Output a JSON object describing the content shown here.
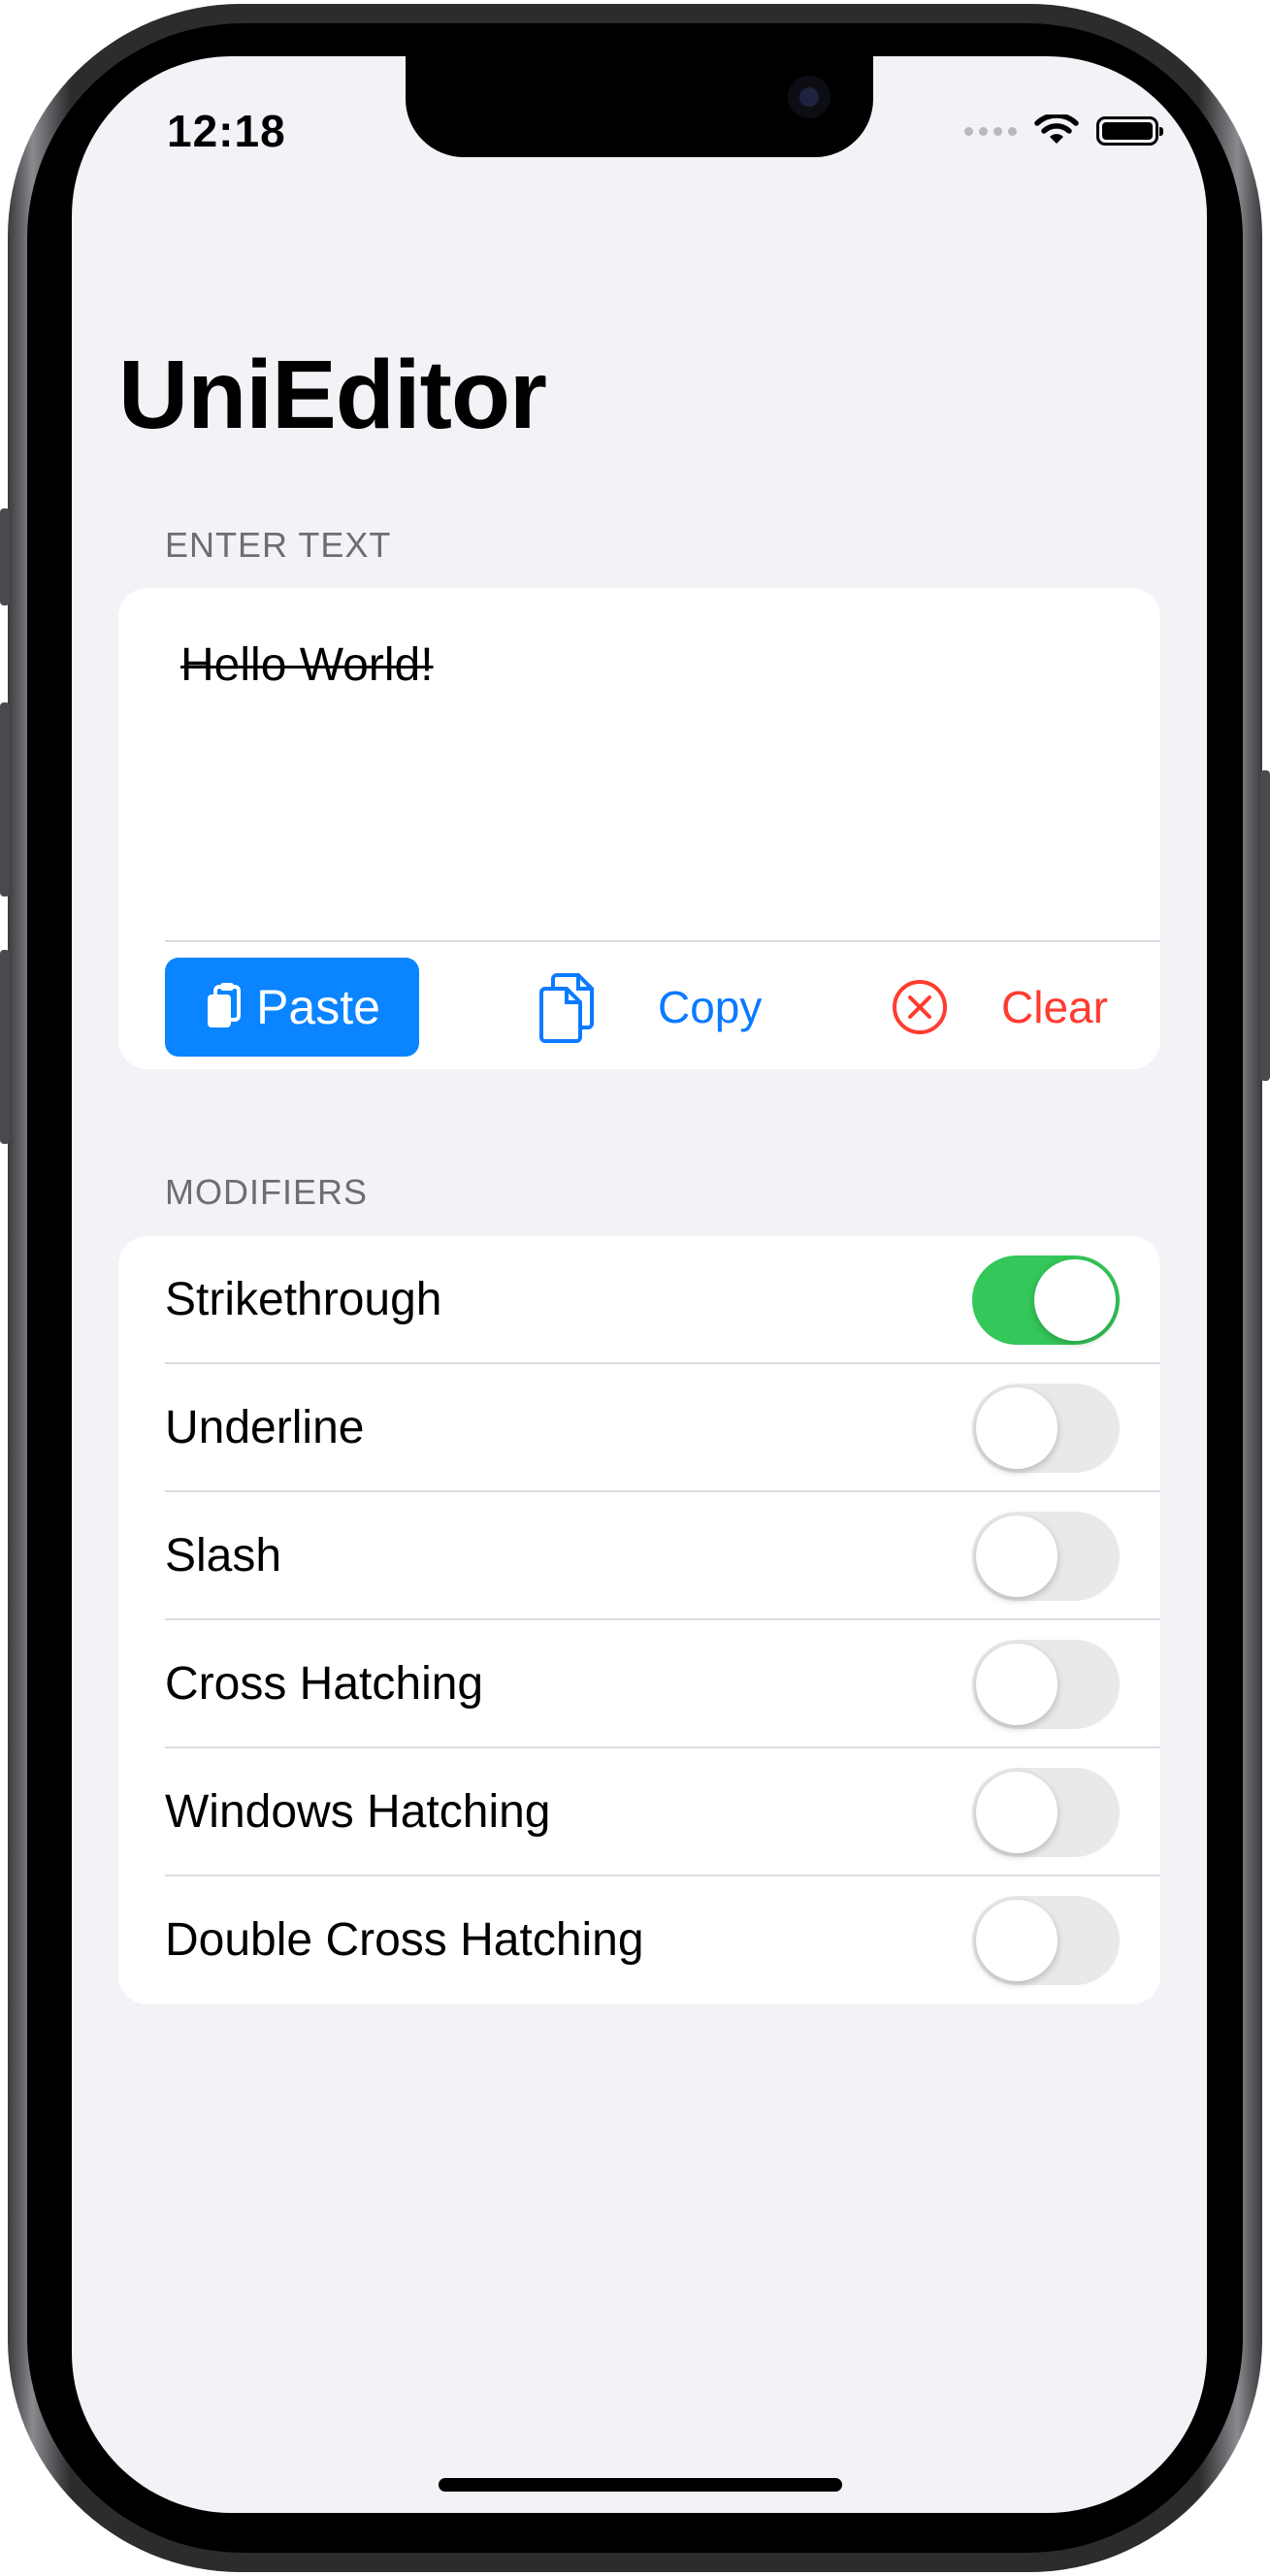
{
  "status_bar": {
    "time": "12:18"
  },
  "app": {
    "title": "UniEditor"
  },
  "input_section": {
    "header": "ENTER TEXT",
    "value": "Hello World!",
    "buttons": {
      "paste": "Paste",
      "copy": "Copy",
      "clear": "Clear"
    }
  },
  "modifiers_section": {
    "header": "MODIFIERS",
    "items": [
      {
        "label": "Strikethrough",
        "enabled": true
      },
      {
        "label": "Underline",
        "enabled": false
      },
      {
        "label": "Slash",
        "enabled": false
      },
      {
        "label": "Cross Hatching",
        "enabled": false
      },
      {
        "label": "Windows Hatching",
        "enabled": false
      },
      {
        "label": "Double Cross Hatching",
        "enabled": false
      }
    ]
  },
  "colors": {
    "accent": "#0a84ff",
    "destructive": "#ff3b30",
    "toggle_on": "#34c759",
    "background": "#f2f2f7"
  },
  "icons": [
    "paste-icon",
    "copy-icon",
    "clear-icon",
    "wifi-icon",
    "battery-icon",
    "cellular-icon"
  ]
}
